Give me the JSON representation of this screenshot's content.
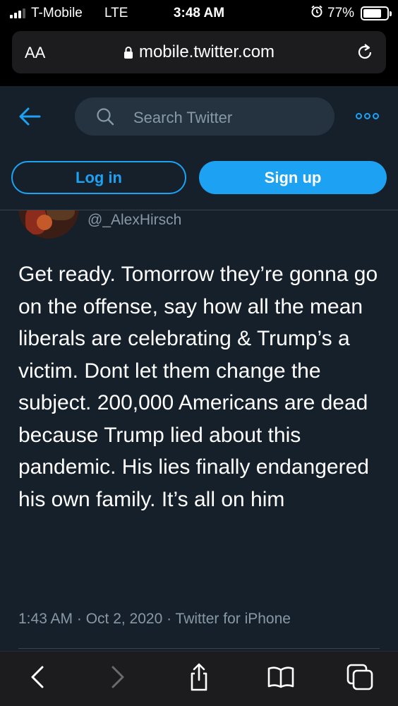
{
  "status_bar": {
    "carrier": "T-Mobile",
    "network": "LTE",
    "time": "3:48 AM",
    "battery": "77%",
    "battery_level": 0.77,
    "icons": [
      "signal-icon",
      "alarm-icon",
      "battery-icon"
    ]
  },
  "url_bar": {
    "text_size_label": "AA",
    "url": "mobile.twitter.com",
    "icons": [
      "lock-icon",
      "reload-icon"
    ]
  },
  "twitter_header": {
    "search_placeholder": "Search Twitter",
    "login_label": "Log in",
    "signup_label": "Sign up",
    "accent_color": "#1da1f2",
    "icons": [
      "back-arrow-icon",
      "search-icon",
      "more-icon"
    ]
  },
  "tweet": {
    "handle": "@_AlexHirsch",
    "text": "Get ready. Tomorrow they’re gonna go on the offense, say how all the mean liberals are celebrating & Trump’s a victim. Dont let them change the subject. 200,000 Americans are dead because Trump lied about this pandemic. His lies finally endangered his own family. It’s all on him",
    "meta": "1:43 AM · Oct 2, 2020 · Twitter for iPhone"
  },
  "toolbar": {
    "icons": [
      "back-icon",
      "forward-icon",
      "share-icon",
      "bookmarks-icon",
      "tabs-icon"
    ]
  },
  "colors": {
    "background": "#15202b",
    "secondary_text": "#8899a6",
    "chrome": "#000000"
  }
}
